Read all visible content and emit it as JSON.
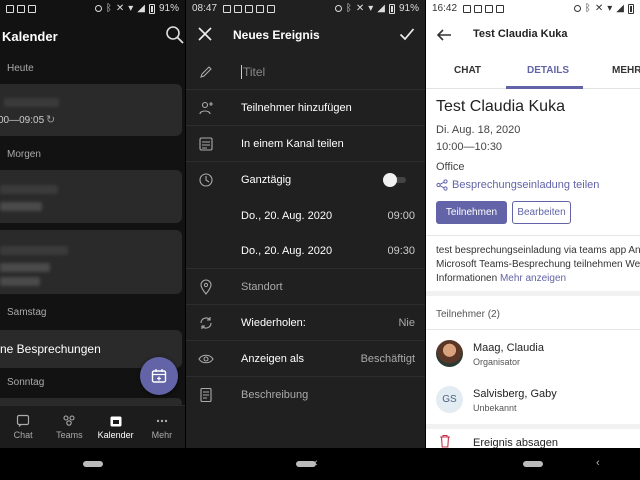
{
  "panel1": {
    "status": {
      "time": "",
      "battery": "91%"
    },
    "header": {
      "title": "Kalender"
    },
    "sections": {
      "today": "Heute",
      "tomorrow": "Morgen",
      "saturday": "Samstag",
      "sunday": "Sonntag"
    },
    "card1": {
      "time": "00—09:05"
    },
    "card3": {
      "text": "ne Besprechungen"
    },
    "tabs": [
      {
        "label": "Chat",
        "icon": "chat-icon"
      },
      {
        "label": "Teams",
        "icon": "teams-icon"
      },
      {
        "label": "Kalender",
        "icon": "calendar-icon"
      },
      {
        "label": "Mehr",
        "icon": "more-icon"
      }
    ],
    "accent": "#6264a7"
  },
  "panel2": {
    "status": {
      "time": "08:47",
      "battery": "91%"
    },
    "header": {
      "title": "Neues Ereignis"
    },
    "rows": {
      "title_placeholder": "Titel",
      "add_participants": "Teilnehmer hinzufügen",
      "share_channel": "In einem Kanal teilen",
      "all_day": "Ganztägig",
      "start_date": "Do., 20. Aug. 2020",
      "start_time": "09:00",
      "end_date": "Do., 20. Aug. 2020",
      "end_time": "09:30",
      "location": "Standort",
      "repeat_label": "Wiederholen:",
      "repeat_value": "Nie",
      "show_as_label": "Anzeigen als",
      "show_as_value": "Beschäftigt",
      "description": "Beschreibung"
    }
  },
  "panel3": {
    "status": {
      "time": "16:42",
      "battery": "91%"
    },
    "header": {
      "title": "Test Claudia Kuka"
    },
    "tabs": {
      "chat": "CHAT",
      "details": "DETAILS",
      "more": "MEHR"
    },
    "event": {
      "title": "Test Claudia Kuka",
      "date": "Di. Aug. 18, 2020",
      "time": "10:00—10:30",
      "location": "Office",
      "share_link": "Besprechungseinladung teilen"
    },
    "buttons": {
      "join": "Teilnehmen",
      "edit": "Bearbeiten"
    },
    "description": "test besprechungseinladung via teams app  An Microsoft Teams-Besprechung teilnehmen Weitere Informationen",
    "more_link": "Mehr anzeigen",
    "participants_header": "Teilnehmer (2)",
    "participants": [
      {
        "name": "Maag, Claudia",
        "role": "Organisator",
        "initials": ""
      },
      {
        "name": "Salvisberg, Gaby",
        "role": "Unbekannt",
        "initials": "GS"
      }
    ],
    "cancel_label": "Ereignis absagen"
  }
}
